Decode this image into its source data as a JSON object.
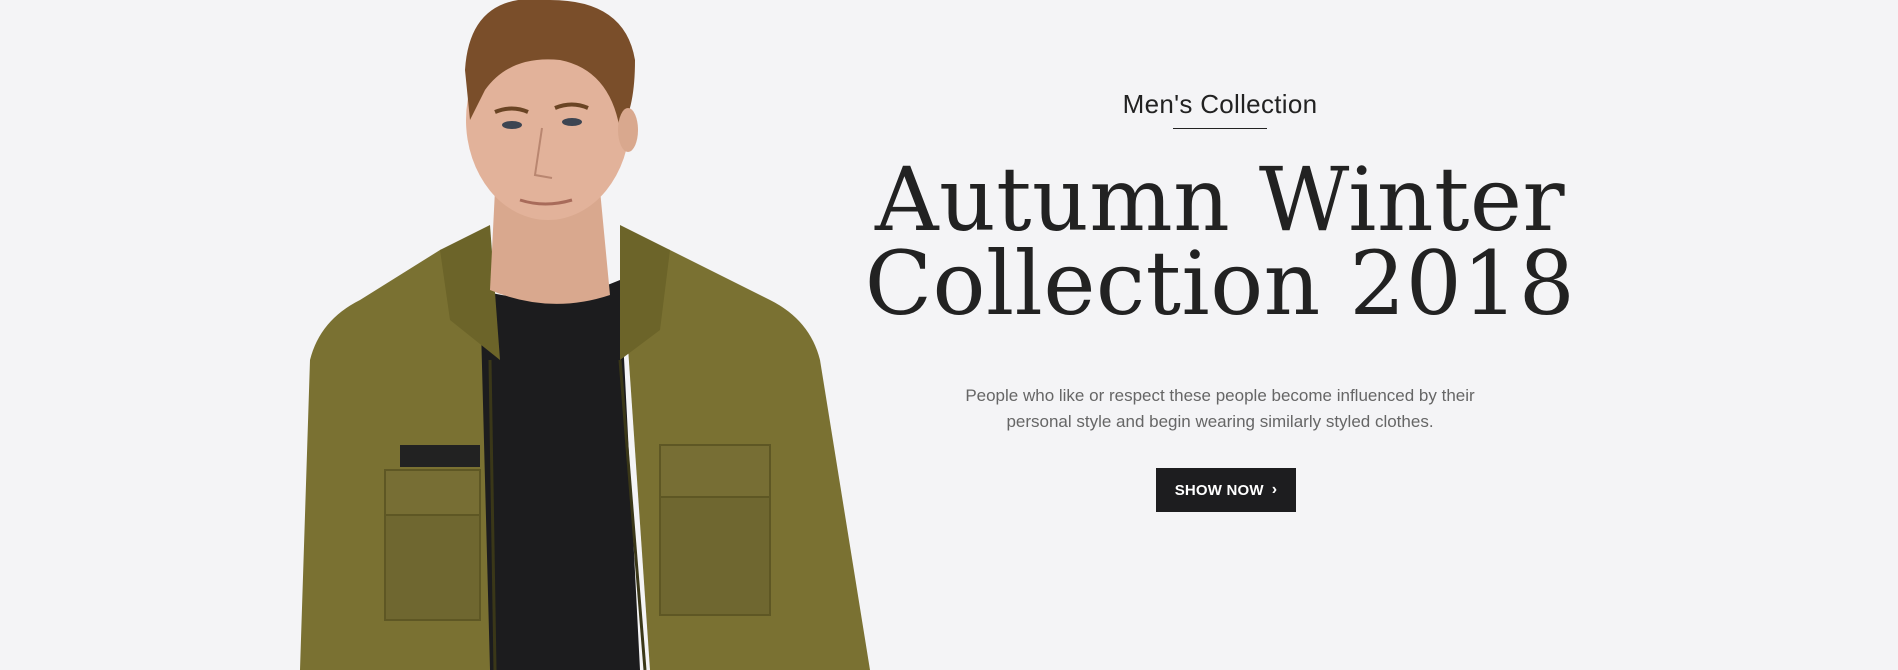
{
  "hero": {
    "eyebrow": "Men's Collection",
    "headline_line1": "Autumn Winter",
    "headline_line2": "Collection 2018",
    "description": "People who like or respect these people become influenced by their personal style and begin wearing similarly styled clothes.",
    "cta_label": "SHOW NOW",
    "cta_icon": "chevron-right-icon",
    "cta_glyph": "›",
    "model_image": "model-photo"
  },
  "colors": {
    "background": "#f4f4f6",
    "text_dark": "#222222",
    "text_muted": "#666666",
    "button_bg": "#1d1d1f",
    "button_text": "#ffffff",
    "jacket": "#7a7132"
  }
}
